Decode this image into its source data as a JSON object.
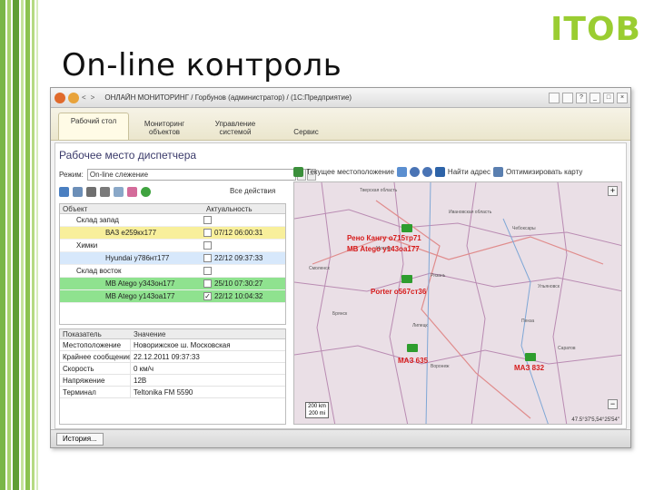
{
  "slide": {
    "title": "On-line контроль",
    "brand": "ITOB"
  },
  "window": {
    "title": "ОНЛАЙН МОНИТОРИНГ / Горбунов (администратор) / (1С:Предприятие)",
    "nav_back": "<",
    "nav_forward": ">"
  },
  "tabs": [
    {
      "label": "Рабочий стол",
      "active": true
    },
    {
      "label": "Мониторинг объектов",
      "active": false
    },
    {
      "label": "Управление системой",
      "active": false
    },
    {
      "label": "Сервис",
      "active": false
    }
  ],
  "workplace": {
    "title": "Рабочее место диспетчера",
    "mode_label": "Режим:",
    "mode_value": "On-line слежение",
    "all_actions": "Все действия",
    "current_location": "Текущее местоположение",
    "find_address": "Найти адрес",
    "fit_map": "Оптимизировать карту"
  },
  "objects_table": {
    "col_object": "Объект",
    "col_actual": "Актуальность",
    "rows": [
      {
        "name": "Склад запад",
        "date": "",
        "checked": false,
        "style": "group"
      },
      {
        "name": "ВАЗ е259кх177",
        "date": "07/12 06:00:31",
        "checked": false,
        "style": "yellow"
      },
      {
        "name": "Химки",
        "date": "",
        "checked": false,
        "style": "group"
      },
      {
        "name": "Hyundai у786нт177",
        "date": "22/12 09:37:33",
        "checked": false,
        "style": "blue"
      },
      {
        "name": "Склад восток",
        "date": "",
        "checked": false,
        "style": "group"
      },
      {
        "name": "MB Atego у343он177",
        "date": "25/10 07:30:27",
        "checked": false,
        "style": "green"
      },
      {
        "name": "MB Atego у143оа177",
        "date": "22/12 10:04:32",
        "checked": true,
        "style": "green"
      }
    ]
  },
  "props_table": {
    "col_indicator": "Показатель",
    "col_value": "Значение",
    "rows": [
      {
        "k": "Местоположение",
        "v": "Новорижское ш. Московская"
      },
      {
        "k": "Крайнее сообщение",
        "v": "22.12.2011 09:37:33"
      },
      {
        "k": "Скорость",
        "v": "0 км/ч"
      },
      {
        "k": "Напряжение",
        "v": "12В"
      },
      {
        "k": "Терминал",
        "v": "Teltonika FM 5590"
      }
    ]
  },
  "map": {
    "vehicles": [
      {
        "label": "Рено Кангу о715тр71"
      },
      {
        "label": "MB Atego у143оа177"
      },
      {
        "label": "Porter о567ст36"
      },
      {
        "label": "МАЗ 635"
      },
      {
        "label": "МАЗ 832"
      }
    ],
    "cities": [
      "Тверская область",
      "Ивановская область",
      "Чебоксары",
      "Москва",
      "Рязань",
      "Ульяновск",
      "Смоленск",
      "Брянск",
      "Липецк",
      "Воронеж",
      "Саратов",
      "Пенза"
    ],
    "scale_top": "200 km",
    "scale_bottom": "200 mi",
    "coords": "47.5°37'5,54°25'54\""
  },
  "statusbar": {
    "history": "История..."
  },
  "colors": {
    "accent": "#9acd32",
    "row_yellow": "#f8ef9b",
    "row_blue": "#d7e8fb",
    "row_green": "#8fe28f",
    "vehicle_label": "#d61b1b"
  }
}
